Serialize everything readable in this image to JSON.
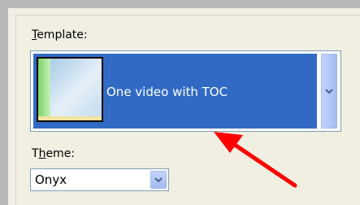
{
  "template": {
    "label_access_key": "T",
    "label_rest": "emplate:",
    "selected_value": "One video with TOC",
    "dropdown_icon": "chevron-down-icon"
  },
  "theme": {
    "label_prefix": "T",
    "label_access_key": "h",
    "label_rest": "eme:",
    "selected_value": "Onyx",
    "dropdown_icon": "chevron-down-icon"
  },
  "annotation": {
    "icon": "red-arrow-icon",
    "color": "#ff0000"
  },
  "colors": {
    "selection": "#316ac5",
    "combo_border": "#7f9db9"
  }
}
